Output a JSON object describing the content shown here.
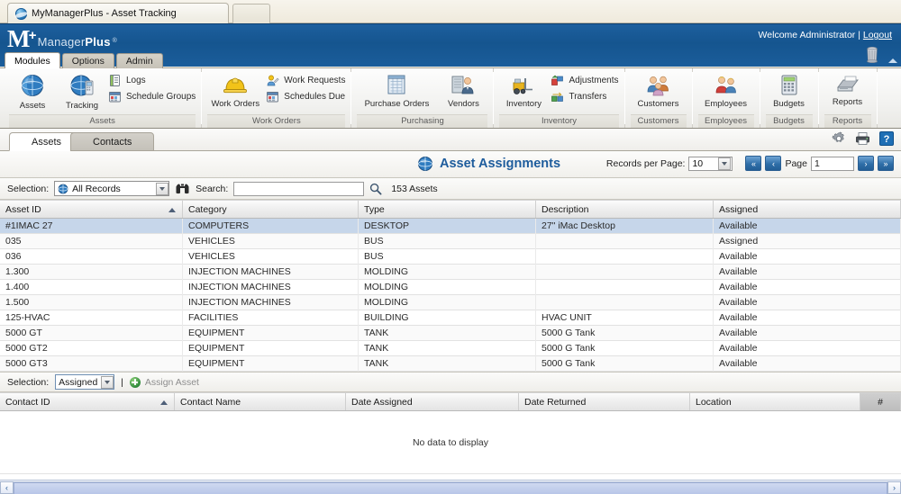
{
  "browser": {
    "tab_title": "MyManagerPlus - Asset Tracking",
    "favicon": "globe-icon",
    "new_tab_label": ""
  },
  "header": {
    "brand_m": "M",
    "brand_plus": "+",
    "brand_manager": "Manager",
    "brand_plus_word": "Plus",
    "brand_tm": "®",
    "welcome_text": "Welcome Administrator | ",
    "logout_label": "Logout",
    "trash_icon": "trash-can-icon"
  },
  "menu_tabs": [
    {
      "label": "Modules",
      "active": true
    },
    {
      "label": "Options",
      "active": false
    },
    {
      "label": "Admin",
      "active": false
    }
  ],
  "ribbon": {
    "groups": [
      {
        "label": "Assets",
        "big": [
          {
            "label": "Assets",
            "icon": "globe-icon"
          },
          {
            "label": "Tracking",
            "icon": "globe-tracking-icon"
          }
        ],
        "small": [
          {
            "label": "Logs",
            "icon": "logs-icon"
          },
          {
            "label": "Schedule Groups",
            "icon": "schedule-groups-icon"
          }
        ]
      },
      {
        "label": "Work Orders",
        "big": [
          {
            "label": "Work Orders",
            "icon": "hardhat-icon"
          }
        ],
        "small": [
          {
            "label": "Work Requests",
            "icon": "work-request-icon"
          },
          {
            "label": "Schedules Due",
            "icon": "schedules-due-icon"
          }
        ]
      },
      {
        "label": "Purchasing",
        "big": [
          {
            "label": "Purchase Orders",
            "icon": "purchase-orders-icon"
          },
          {
            "label": "Vendors",
            "icon": "vendors-icon"
          }
        ],
        "small": []
      },
      {
        "label": "Inventory",
        "big": [
          {
            "label": "Inventory",
            "icon": "forklift-icon"
          }
        ],
        "small": [
          {
            "label": "Adjustments",
            "icon": "adjustments-icon"
          },
          {
            "label": "Transfers",
            "icon": "transfers-icon"
          }
        ]
      },
      {
        "label": "Customers",
        "big": [
          {
            "label": "Customers",
            "icon": "customers-icon"
          }
        ],
        "small": []
      },
      {
        "label": "Employees",
        "big": [
          {
            "label": "Employees",
            "icon": "employees-icon"
          }
        ],
        "small": []
      },
      {
        "label": "Budgets",
        "big": [
          {
            "label": "Budgets",
            "icon": "calculator-icon"
          }
        ],
        "small": []
      },
      {
        "label": "Reports",
        "big": [
          {
            "label": "Reports",
            "icon": "printer-report-icon"
          }
        ],
        "small": []
      }
    ]
  },
  "content_tabs": [
    {
      "label": "Assets",
      "active": true
    },
    {
      "label": "Contacts",
      "active": false
    }
  ],
  "content_tab_icons": [
    {
      "name": "gear-icon"
    },
    {
      "name": "printer-icon"
    },
    {
      "name": "help-icon",
      "label": "?"
    }
  ],
  "page": {
    "title": "Asset Assignments",
    "title_icon": "globe-icon",
    "records_per_page_label": "Records per Page:",
    "records_per_page_value": "10",
    "page_label": "Page",
    "page_value": "1",
    "first_page_glyph": "«",
    "prev_page_glyph": "‹",
    "next_page_glyph": "›",
    "last_page_glyph": "»"
  },
  "toolbar": {
    "selection_label": "Selection:",
    "selection_value": "All Records",
    "selection_icon": "globe-icon",
    "binoculars_icon": "binoculars-icon",
    "search_label": "Search:",
    "search_value": "",
    "search_placeholder": "",
    "search_icon": "magnifier-icon",
    "record_count": "153 Assets"
  },
  "asset_grid": {
    "columns": [
      "Asset ID",
      "Category",
      "Type",
      "Description",
      "Assigned"
    ],
    "sorted_column_index": 0,
    "sort_direction": "asc",
    "rows": [
      {
        "asset_id": "#1IMAC 27",
        "category": "COMPUTERS",
        "type": "DESKTOP",
        "description": "27\" iMac Desktop",
        "assigned": "Available",
        "selected": true
      },
      {
        "asset_id": "035",
        "category": "VEHICLES",
        "type": "BUS",
        "description": "",
        "assigned": "Assigned",
        "selected": false
      },
      {
        "asset_id": "036",
        "category": "VEHICLES",
        "type": "BUS",
        "description": "",
        "assigned": "Available",
        "selected": false
      },
      {
        "asset_id": "1.300",
        "category": "INJECTION MACHINES",
        "type": "MOLDING",
        "description": "",
        "assigned": "Available",
        "selected": false
      },
      {
        "asset_id": "1.400",
        "category": "INJECTION MACHINES",
        "type": "MOLDING",
        "description": "",
        "assigned": "Available",
        "selected": false
      },
      {
        "asset_id": "1.500",
        "category": "INJECTION MACHINES",
        "type": "MOLDING",
        "description": "",
        "assigned": "Available",
        "selected": false
      },
      {
        "asset_id": "125-HVAC",
        "category": "FACILITIES",
        "type": "BUILDING",
        "description": "HVAC UNIT",
        "assigned": "Available",
        "selected": false
      },
      {
        "asset_id": "5000 GT",
        "category": "EQUIPMENT",
        "type": "TANK",
        "description": "5000 G Tank",
        "assigned": "Available",
        "selected": false
      },
      {
        "asset_id": "5000 GT2",
        "category": "EQUIPMENT",
        "type": "TANK",
        "description": "5000 G Tank",
        "assigned": "Available",
        "selected": false
      },
      {
        "asset_id": "5000 GT3",
        "category": "EQUIPMENT",
        "type": "TANK",
        "description": "5000 G Tank",
        "assigned": "Available",
        "selected": false
      }
    ]
  },
  "lower_toolbar": {
    "selection_label": "Selection:",
    "selection_value": "Assigned",
    "divider": "|",
    "assign_asset_label": "Assign Asset",
    "assign_icon": "add-circle-icon"
  },
  "contact_grid": {
    "columns": [
      "Contact ID",
      "Contact Name",
      "Date Assigned",
      "Date Returned",
      "Location",
      "#"
    ],
    "sorted_column_index": 0,
    "sort_direction": "asc",
    "empty_message": "No data to display",
    "rows": []
  },
  "scrollbar": {
    "left_glyph": "‹",
    "right_glyph": "›"
  },
  "colors": {
    "brand_blue": "#15558f",
    "title_blue": "#1d5c9c",
    "row_selected": "#c6d6ea",
    "tab_inactive": "#c4c1b9"
  }
}
